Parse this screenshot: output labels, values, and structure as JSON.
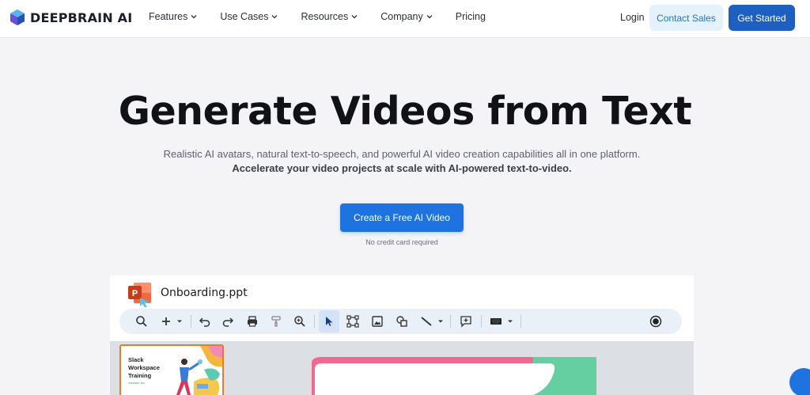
{
  "nav": {
    "brand": "DEEPBRAIN AI",
    "menu": [
      {
        "label": "Features",
        "has_dropdown": true
      },
      {
        "label": "Use Cases",
        "has_dropdown": true
      },
      {
        "label": "Resources",
        "has_dropdown": true
      },
      {
        "label": "Company",
        "has_dropdown": true
      },
      {
        "label": "Pricing",
        "has_dropdown": false
      }
    ],
    "login": "Login",
    "contact_sales": "Contact Sales",
    "get_started": "Get Started"
  },
  "hero": {
    "title": "Generate Videos from Text",
    "subtitle_line1": "Realistic AI avatars, natural text-to-speech, and powerful AI video creation capabilities all in one platform.",
    "subtitle_line2": "Accelerate your video projects at scale with AI-powered text-to-video.",
    "cta": "Create a Free AI Video",
    "cta_note": "No credit card required"
  },
  "app": {
    "file_name": "Onboarding.ppt",
    "toolbar_icons": [
      "search-icon",
      "add-icon",
      "chevron-down-icon",
      "undo-icon",
      "redo-icon",
      "print-icon",
      "paint-format-icon",
      "zoom-icon",
      "cursor-icon",
      "select-frame-icon",
      "image-icon",
      "shapes-icon",
      "line-icon",
      "chevron-down-icon",
      "comment-add-icon",
      "keyboard-icon",
      "chevron-down-icon",
      "record-icon"
    ],
    "thumbnail": {
      "title_lines": [
        "Slack",
        "Workspace",
        "Training"
      ],
      "sub": "Jobbber Inc."
    }
  },
  "colors": {
    "primary": "#1f73e0",
    "get_started_bg": "#1e5fc2",
    "contact_bg": "#e5f1fb",
    "page_bg": "#f4f4f6",
    "ppt_orange": "#d24726"
  }
}
